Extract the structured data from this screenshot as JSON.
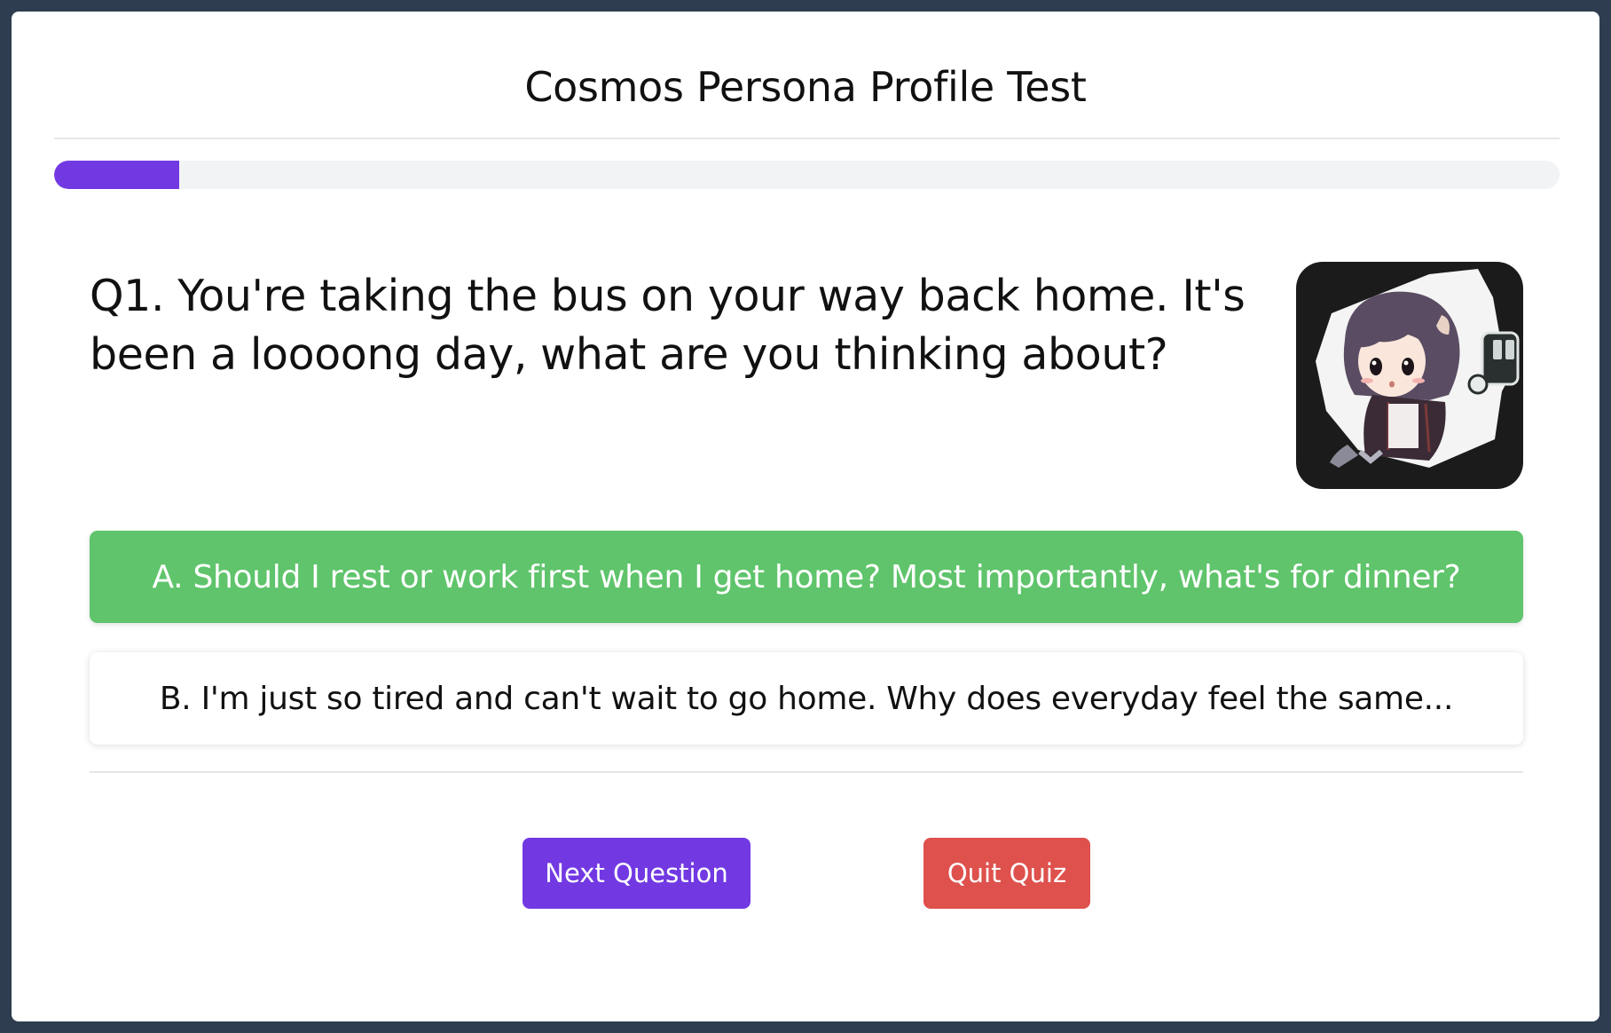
{
  "quiz": {
    "title": "Cosmos Persona Profile Test",
    "progress_fraction": 0.083,
    "progress_color": "#7239e3"
  },
  "question": {
    "text": "Q1. You're taking the bus on your way back home. It's been a loooong day, what are you thinking about?",
    "illustration_icon": "anime-girl-on-bus-illustration"
  },
  "options": [
    {
      "label": "A. Should I rest or work first when I get home? Most importantly, what's for dinner?",
      "selected": true,
      "color": "#5fc46b"
    },
    {
      "label": "B. I'm just so tired and can't wait to go home. Why does everyday feel the same...",
      "selected": false,
      "color": "#ffffff"
    }
  ],
  "actions": {
    "next_label": "Next Question",
    "next_color": "#7239e3",
    "quit_label": "Quit Quiz",
    "quit_color": "#de514d"
  }
}
